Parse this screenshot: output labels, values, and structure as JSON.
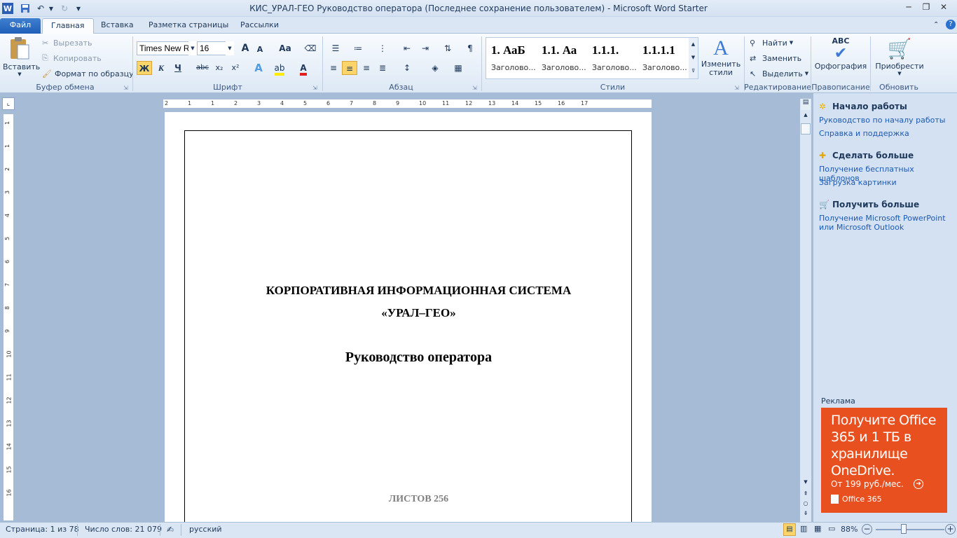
{
  "window": {
    "title": "КИС_УРАЛ-ГЕО Руководство оператора (Последнее сохранение пользователем)  -  Microsoft Word Starter"
  },
  "tabs": [
    "Файл",
    "Главная",
    "Вставка",
    "Разметка страницы",
    "Рассылки"
  ],
  "ribbon": {
    "clipboard": {
      "paste": "Вставить",
      "cut": "Вырезать",
      "copy": "Копировать",
      "format_painter": "Формат по образцу",
      "label": "Буфер обмена"
    },
    "font": {
      "font_name": "Times New Rc",
      "font_size": "16",
      "label": "Шрифт",
      "bold": "Ж",
      "italic": "К",
      "underline": "Ч",
      "strike": "abc",
      "subscript": "x₂",
      "superscript": "x²",
      "grow": "A",
      "shrink": "A",
      "case": "Aa"
    },
    "paragraph": {
      "label": "Абзац"
    },
    "styles": {
      "label": "Стили",
      "items": [
        {
          "sample": "1.  АаБ",
          "name": "Заголово..."
        },
        {
          "sample": "1.1.  Аа",
          "name": "Заголово..."
        },
        {
          "sample": "1.1.1.",
          "name": "Заголово..."
        },
        {
          "sample": "1.1.1.1",
          "name": "Заголово..."
        }
      ],
      "change_styles": "Изменить стили"
    },
    "editing": {
      "label": "Редактирование",
      "find": "Найти",
      "replace": "Заменить",
      "select": "Выделить"
    },
    "proofing": {
      "label": "Правописание",
      "spelling": "Орфография",
      "abc": "ABC"
    },
    "update": {
      "label": "Обновить",
      "buy": "Приобрести"
    }
  },
  "document": {
    "line1": "КОРПОРАТИВНАЯ ИНФОРМАЦИОННАЯ СИСТЕМА",
    "line2": "«УРАЛ–ГЕО»",
    "subtitle": "Руководство оператора",
    "sheets": "ЛИСТОВ 256"
  },
  "ruler": {
    "top_ticks": [
      "2",
      "1",
      "1",
      "2",
      "3",
      "4",
      "5",
      "6",
      "7",
      "8",
      "9",
      "10",
      "11",
      "12",
      "13",
      "14",
      "15",
      "16",
      "17"
    ],
    "left_ticks": [
      "1",
      "1",
      "2",
      "3",
      "4",
      "5",
      "6",
      "7",
      "8",
      "9",
      "10",
      "11",
      "12",
      "13",
      "14",
      "15",
      "16"
    ]
  },
  "right_pane": {
    "section1": {
      "title": "Начало работы",
      "links": [
        "Руководство по началу работы",
        "Справка и поддержка"
      ]
    },
    "section2": {
      "title": "Сделать больше",
      "links": [
        "Получение бесплатных шаблонов",
        "Загрузка картинки"
      ]
    },
    "section3": {
      "title": "Получить больше",
      "links": [
        "Получение Microsoft PowerPoint или Microsoft Outlook"
      ]
    },
    "ad_label": "Реклама",
    "ad": {
      "headline": "Получите Office 365 и 1 ТБ в хранилище OneDrive.",
      "price": "От 199 руб./мес.",
      "brand": "Office 365",
      "accent": "#e9501f"
    }
  },
  "status": {
    "page": "Страница: 1 из 78",
    "words": "Число слов: 21 079",
    "language": "русский",
    "zoom": "88%"
  }
}
